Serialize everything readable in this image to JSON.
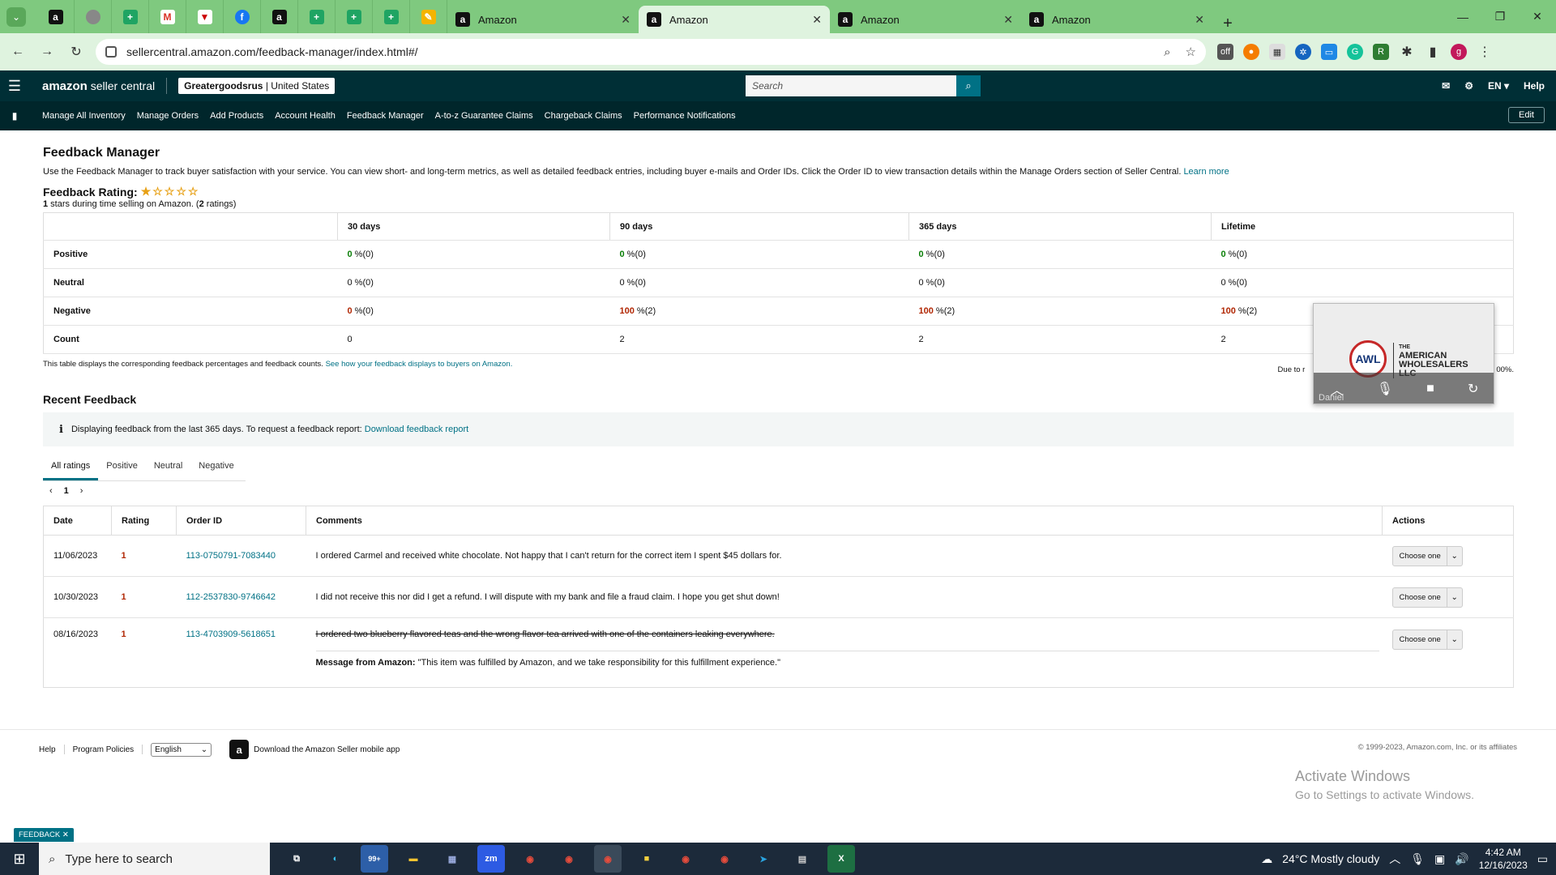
{
  "browser": {
    "pinned_icons": [
      "amazon-icon",
      "grey-circle-icon",
      "sheets-icon",
      "gmail-icon",
      "red-triangle-icon",
      "facebook-icon",
      "amazon-icon",
      "sheets-icon",
      "sheets-icon",
      "sheets-icon",
      "pen-icon"
    ],
    "tabs": [
      {
        "title": "Amazon",
        "active": false
      },
      {
        "title": "Amazon",
        "active": true
      },
      {
        "title": "Amazon",
        "active": false
      },
      {
        "title": "Amazon",
        "active": false
      }
    ],
    "url": "sellercentral.amazon.com/feedback-manager/index.html#/",
    "profile_initial": "g"
  },
  "header": {
    "logo_main": "amazon",
    "logo_sub": " seller central",
    "account_store": "Greatergoodsrus",
    "account_region": " | United States",
    "search_placeholder": "Search",
    "language": "EN ▾",
    "help": "Help"
  },
  "nav": {
    "links": [
      "Manage All Inventory",
      "Manage Orders",
      "Add Products",
      "Account Health",
      "Feedback Manager",
      "A-to-z Guarantee Claims",
      "Chargeback Claims",
      "Performance Notifications"
    ],
    "edit": "Edit"
  },
  "page": {
    "title": "Feedback Manager",
    "description": "Use the Feedback Manager to track buyer satisfaction with your service. You can view short- and long-term metrics, as well as detailed feedback entries, including buyer e-mails and Order IDs. Click the Order ID to view transaction details within the Manage Orders section of Seller Central.",
    "learn_more": "Learn more",
    "rating_label": "Feedback Rating:",
    "rating_stars": 1,
    "rating_stars_text": "★☆☆☆☆",
    "rating_value": "1",
    "rating_mid": " stars during time selling on Amazon. (",
    "rating_count": "2",
    "rating_end": " ratings)"
  },
  "metrics": {
    "columns": [
      "30 days",
      "90 days",
      "365 days",
      "Lifetime"
    ],
    "rows": [
      {
        "label": "Positive",
        "cells": [
          {
            "n": "0",
            "s": " %(0)",
            "c": "g"
          },
          {
            "n": "0",
            "s": " %(0)",
            "c": "g"
          },
          {
            "n": "0",
            "s": " %(0)",
            "c": "g"
          },
          {
            "n": "0",
            "s": " %(0)",
            "c": "g"
          }
        ]
      },
      {
        "label": "Neutral",
        "cells": [
          {
            "n": "0",
            "s": " %(0)",
            "c": ""
          },
          {
            "n": "0",
            "s": " %(0)",
            "c": ""
          },
          {
            "n": "0",
            "s": " %(0)",
            "c": ""
          },
          {
            "n": "0",
            "s": " %(0)",
            "c": ""
          }
        ]
      },
      {
        "label": "Negative",
        "cells": [
          {
            "n": "0",
            "s": " %(0)",
            "c": "r"
          },
          {
            "n": "100",
            "s": " %(2)",
            "c": "r"
          },
          {
            "n": "100",
            "s": " %(2)",
            "c": "r"
          },
          {
            "n": "100",
            "s": " %(2)",
            "c": "r"
          }
        ]
      },
      {
        "label": "Count",
        "cells": [
          {
            "n": "0",
            "s": "",
            "c": ""
          },
          {
            "n": "2",
            "s": "",
            "c": ""
          },
          {
            "n": "2",
            "s": "",
            "c": ""
          },
          {
            "n": "2",
            "s": "",
            "c": ""
          }
        ]
      }
    ],
    "note": "This table displays the corresponding feedback percentages and feedback counts.",
    "note_link": "See how your feedback displays to buyers on Amazon.",
    "note_right_start": "Due to r",
    "note_right_end": "00%."
  },
  "recent": {
    "title": "Recent Feedback",
    "info": "Displaying feedback from the last 365 days. To request a feedback report:",
    "info_link": "Download feedback report",
    "tabs": [
      "All ratings",
      "Positive",
      "Neutral",
      "Negative"
    ],
    "active_tab": "All ratings",
    "page": "1",
    "columns": [
      "Date",
      "Rating",
      "Order ID",
      "Comments",
      "Actions"
    ],
    "rows": [
      {
        "date": "11/06/2023",
        "rating": "1",
        "order_id": "113-0750791-7083440",
        "comment": "I ordered Carmel and received white chocolate. Not happy that I can't return for the correct item I spent $45 dollars for.",
        "action": "Choose one"
      },
      {
        "date": "10/30/2023",
        "rating": "1",
        "order_id": "112-2537830-9746642",
        "comment": "I did not receive this nor did I get a refund. I will dispute with my bank and file a fraud claim. I hope you get shut down!",
        "action": "Choose one"
      },
      {
        "date": "08/16/2023",
        "rating": "1",
        "order_id": "113-4703909-5618651",
        "comment": "I ordered two blueberry flavored teas and the wrong flavor tea arrived with one of the containers leaking everywhere.",
        "action": "Choose one",
        "struck": true,
        "amazon_label": "Message from Amazon:",
        "amazon_message": " \"This item was fulfilled by Amazon, and we take responsibility for this fulfillment experience.\""
      }
    ]
  },
  "footer": {
    "help": "Help",
    "policies": "Program Policies",
    "language": "English",
    "app_text": "Download the Amazon Seller mobile app",
    "copyright": "© 1999-2023, Amazon.com, Inc. or its affiliates",
    "feedback_badge": "FEEDBACK ✕",
    "activate_title": "Activate Windows",
    "activate_sub": "Go to Settings to activate Windows."
  },
  "video": {
    "logo_initials": "AWL",
    "company_line1": "THE",
    "company_line2": "AMERICAN",
    "company_line3": "WHOLESALERS",
    "company_line4": "LLC",
    "participant": "Daniel"
  },
  "taskbar": {
    "search_placeholder": "Type here to search",
    "badge_mail": "99+",
    "weather": "24°C  Mostly cloudy",
    "time": "4:42 AM",
    "date": "12/16/2023"
  },
  "colors": {
    "tabbar": "#7fc97f",
    "sc_header": "#002f36",
    "link": "#007185",
    "positive": "#0a7e07",
    "negative": "#b12704"
  }
}
